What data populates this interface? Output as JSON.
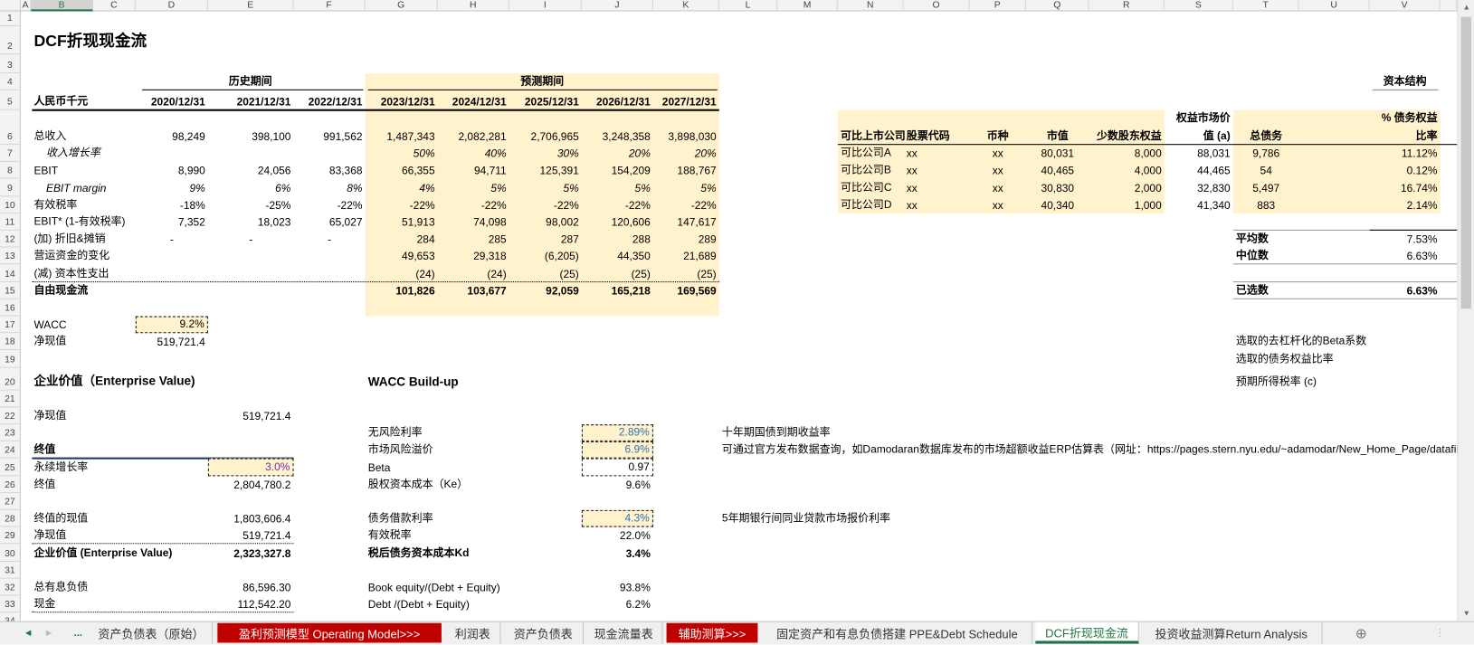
{
  "column_headers": [
    "A",
    "B",
    "C",
    "D",
    "E",
    "F",
    "G",
    "H",
    "I",
    "J",
    "K",
    "L",
    "M",
    "N",
    "O",
    "P",
    "Q",
    "R",
    "S",
    "T",
    "U",
    "V"
  ],
  "selected_column": "B",
  "row_numbers": [
    1,
    2,
    3,
    4,
    5,
    6,
    7,
    8,
    9,
    10,
    11,
    12,
    13,
    14,
    15,
    16,
    17,
    18,
    19,
    20,
    21,
    22,
    23,
    24,
    25,
    26,
    27,
    28,
    29,
    30,
    31,
    32,
    33,
    34
  ],
  "title": "DCF折现现金流",
  "income": {
    "units_label": "人民币千元",
    "history_label": "历史期间",
    "forecast_label": "预测期间",
    "years": [
      "2020/12/31",
      "2021/12/31",
      "2022/12/31",
      "2023/12/31",
      "2024/12/31",
      "2025/12/31",
      "2026/12/31",
      "2027/12/31"
    ],
    "rows": [
      {
        "label": "总收入",
        "style": "",
        "values": [
          "98,249",
          "398,100",
          "991,562",
          "1,487,343",
          "2,082,281",
          "2,706,965",
          "3,248,358",
          "3,898,030"
        ]
      },
      {
        "label": "收入增长率",
        "style": "italic",
        "values": [
          "",
          "",
          "",
          "50%",
          "40%",
          "30%",
          "20%",
          "20%"
        ]
      },
      {
        "label": "EBIT",
        "style": "",
        "values": [
          "8,990",
          "24,056",
          "83,368",
          "66,355",
          "94,711",
          "125,391",
          "154,209",
          "188,767"
        ]
      },
      {
        "label": "EBIT margin",
        "style": "italic",
        "values": [
          "9%",
          "6%",
          "8%",
          "4%",
          "5%",
          "5%",
          "5%",
          "5%"
        ]
      },
      {
        "label": "有效税率",
        "style": "",
        "values": [
          "-18%",
          "-25%",
          "-22%",
          "-22%",
          "-22%",
          "-22%",
          "-22%",
          "-22%"
        ]
      },
      {
        "label": "EBIT* (1-有效税率)",
        "style": "",
        "values": [
          "7,352",
          "18,023",
          "65,027",
          "51,913",
          "74,098",
          "98,002",
          "120,606",
          "147,617"
        ]
      },
      {
        "label": "(加) 折旧&摊销",
        "style": "",
        "values": [
          "-",
          "-",
          "-",
          "284",
          "285",
          "287",
          "288",
          "289"
        ]
      },
      {
        "label": "营运资金的变化",
        "style": "",
        "values": [
          "",
          "",
          "",
          "49,653",
          "29,318",
          "(6,205)",
          "44,350",
          "21,689"
        ]
      },
      {
        "label": "(减) 资本性支出",
        "style": "",
        "values": [
          "",
          "",
          "",
          "(24)",
          "(24)",
          "(25)",
          "(25)",
          "(25)"
        ]
      },
      {
        "label": "自由现金流",
        "style": "bold",
        "values": [
          "",
          "",
          "",
          "101,826",
          "103,677",
          "92,059",
          "165,218",
          "169,569"
        ]
      }
    ]
  },
  "wacc_summary": {
    "wacc_label": "WACC",
    "wacc": "9.2%",
    "npv_label": "净现值",
    "npv": "519,721.4"
  },
  "enterprise_value": {
    "title": "企业价值（Enterprise Value)",
    "npv_label": "净现值",
    "npv": "519,721.4",
    "terminal_header": "终值",
    "growth_label": "永续增长率",
    "growth": "3.0%",
    "terminal_label": "终值",
    "terminal": "2,804,780.2",
    "pv_terminal_label": "终值的现值",
    "pv_terminal": "1,803,606.4",
    "npv2_label": "净现值",
    "npv2": "519,721.4",
    "ev_label": "企业价值 (Enterprise Value)",
    "ev": "2,323,327.8",
    "debt_label": "总有息负债",
    "debt": "86,596.30",
    "cash_label": "现金",
    "cash": "112,542.20"
  },
  "wacc_buildup": {
    "title": "WACC Build-up",
    "items": [
      {
        "label": "无风险利率",
        "value": "2.89%"
      },
      {
        "label": "市场风险溢价",
        "value": "6.9%"
      },
      {
        "label": "Beta",
        "value": "0.97"
      },
      {
        "label": "股权资本成本（Ke）",
        "value": "9.6%"
      },
      {
        "label": "债务借款利率",
        "value": "4.3%"
      },
      {
        "label": "有效税率",
        "value": "22.0%"
      },
      {
        "label": "税后债务资本成本Kd",
        "value": "3.4%"
      },
      {
        "label": "Book equity/(Debt + Equity)",
        "value": "93.8%"
      },
      {
        "label": "Debt /(Debt + Equity)",
        "value": "6.2%"
      }
    ]
  },
  "notes": {
    "risk_free": "十年期国债到期收益率",
    "erp": "可通过官方发布数据查询，如Damodaran数据库发布的市场超额收益ERP估算表（网址：https://pages.stern.nyu.edu/~adamodar/New_Home_Page/datafile/ctryprem.html）",
    "debt_rate": "5年期银行间同业贷款市场报价利率"
  },
  "comparables": {
    "headers": [
      "可比上市公司",
      "股票代码",
      "币种",
      "市值",
      "少数股东权益",
      "权益市场价",
      "值 (a)",
      "总债务",
      "% 债务权益",
      "比率"
    ],
    "rows": [
      [
        "可比公司A",
        "xx",
        "xx",
        "80,031",
        "8,000",
        "88,031",
        "9,786",
        "11.12%"
      ],
      [
        "可比公司B",
        "xx",
        "xx",
        "40,465",
        "4,000",
        "44,465",
        "54",
        "0.12%"
      ],
      [
        "可比公司C",
        "xx",
        "xx",
        "30,830",
        "2,000",
        "32,830",
        "5,497",
        "16.74%"
      ],
      [
        "可比公司D",
        "xx",
        "xx",
        "40,340",
        "1,000",
        "41,340",
        "883",
        "2.14%"
      ]
    ]
  },
  "capital_structure": {
    "title": "资本结构",
    "average_label": "平均数",
    "average": "7.53%",
    "median_label": "中位数",
    "median": "6.63%",
    "selected_label": "已选数",
    "selected": "6.63%",
    "notes": [
      "选取的去杠杆化的Beta系数",
      "选取的债务权益比率",
      "预期所得税率 (c)"
    ]
  },
  "tabs": {
    "nav_ellipsis": "...",
    "items": [
      {
        "label": "资产负债表（原始）",
        "style": ""
      },
      {
        "label": "盈利预测模型 Operating Model>>>",
        "style": "red"
      },
      {
        "label": "利润表",
        "style": ""
      },
      {
        "label": "资产负债表",
        "style": ""
      },
      {
        "label": "现金流量表",
        "style": ""
      },
      {
        "label": "辅助测算>>>",
        "style": "red"
      },
      {
        "label": "固定资产和有息负债搭建 PPE&Debt Schedule",
        "style": ""
      },
      {
        "label": "DCF折现现金流",
        "style": "active"
      },
      {
        "label": "投资收益测算Return Analysis",
        "style": ""
      }
    ],
    "add_icon": "plus-circle-icon"
  },
  "colors": {
    "input_fill": "#fff2cc",
    "input_blue": "#2e75b6",
    "input_purple": "#7030a0",
    "tab_red": "#c00000",
    "active_tab": "#217346",
    "ev_rule": "#1f3864"
  }
}
